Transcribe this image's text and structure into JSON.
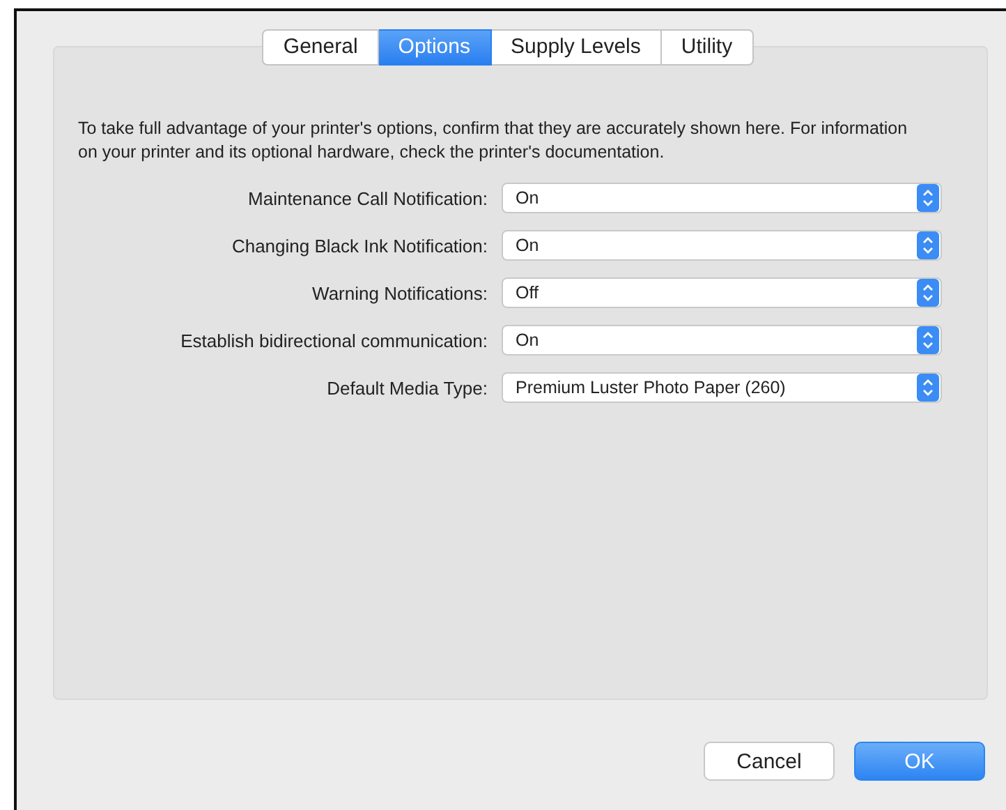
{
  "tabs": [
    {
      "label": "General",
      "selected": false
    },
    {
      "label": "Options",
      "selected": true
    },
    {
      "label": "Supply Levels",
      "selected": false
    },
    {
      "label": "Utility",
      "selected": false
    }
  ],
  "intro": "To take full advantage of your printer's options, confirm that they are accurately shown here. For information on your printer and its optional hardware, check the printer's documentation.",
  "settings": [
    {
      "label": "Maintenance Call Notification:",
      "value": "On"
    },
    {
      "label": "Changing Black Ink Notification:",
      "value": "On"
    },
    {
      "label": "Warning Notifications:",
      "value": "Off"
    },
    {
      "label": "Establish bidirectional communication:",
      "value": "On"
    },
    {
      "label": "Default Media Type:",
      "value": "Premium Luster Photo Paper (260)"
    }
  ],
  "buttons": [
    {
      "label": "Cancel",
      "kind": "default"
    },
    {
      "label": "OK",
      "kind": "primary"
    }
  ]
}
